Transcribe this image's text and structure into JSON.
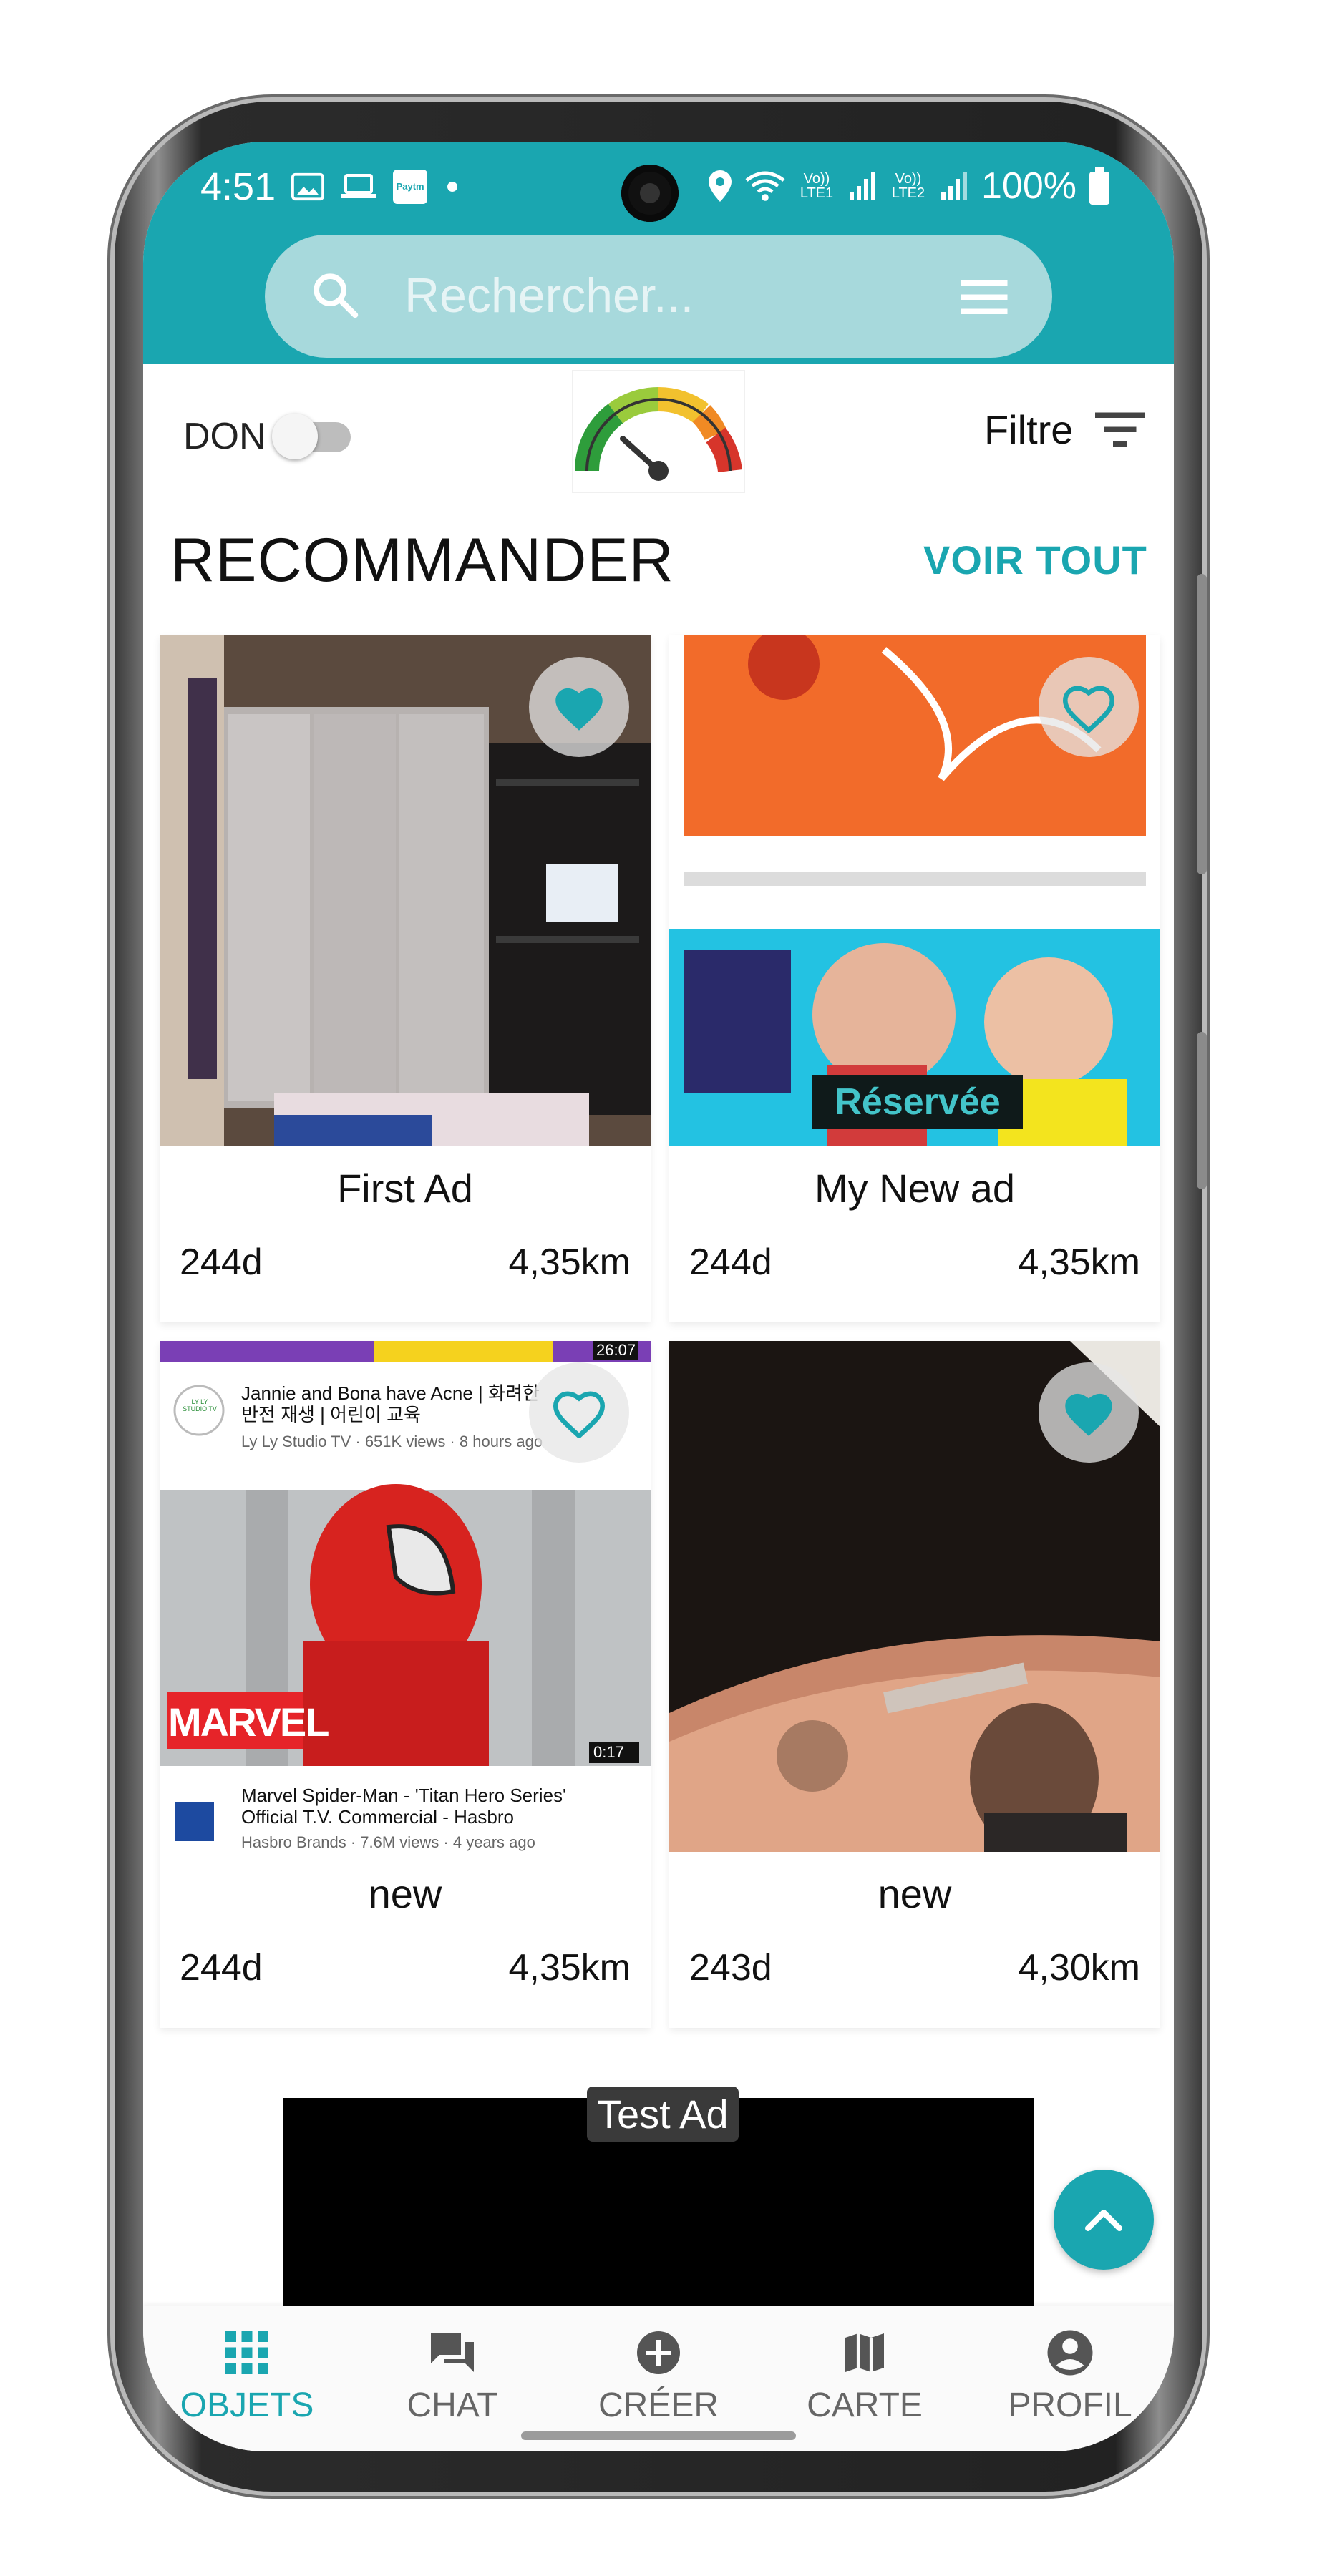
{
  "status": {
    "time": "4:51",
    "volte": "Vo)) LTE1",
    "volte2": "Vo)) LTE2",
    "battery": "100%",
    "paytm": "Paytm"
  },
  "search": {
    "placeholder": "Rechercher..."
  },
  "filterbar": {
    "don_label": "DON",
    "filter_label": "Filtre"
  },
  "section": {
    "title": "RECOMMANDER",
    "see_all": "VOIR TOUT"
  },
  "cards": [
    {
      "title": "First Ad",
      "age": "244d",
      "distance": "4,35km",
      "favorite": true
    },
    {
      "title": "My New ad",
      "age": "244d",
      "distance": "4,35km",
      "favorite": false,
      "badge": "Réservée"
    },
    {
      "title": "new",
      "age": "244d",
      "distance": "4,35km",
      "favorite": false
    },
    {
      "title": "new",
      "age": "243d",
      "distance": "4,30km",
      "favorite": true
    }
  ],
  "thumb_texts": {
    "yt1_title": "Jannie and Bona have Acne | 화려한 반전 재생 | 어린이 교육",
    "yt1_sub": "Ly Ly Studio TV · 651K views · 8 hours ago",
    "yt1_time": "26:07",
    "yt2_title": "Marvel Spider-Man - 'Titan Hero Series' Official T.V. Commercial - Hasbro",
    "yt2_sub": "Hasbro Brands · 7.6M views · 4 years ago",
    "yt2_time": "0:17",
    "marvel": "MARVEL",
    "lyly": "LY LY STUDIO TV"
  },
  "ad": {
    "label": "Test Ad"
  },
  "nav": [
    {
      "label": "OBJETS",
      "icon": "grid-icon",
      "active": true
    },
    {
      "label": "CHAT",
      "icon": "chat-icon",
      "active": false
    },
    {
      "label": "CRÉER",
      "icon": "add-circle-icon",
      "active": false
    },
    {
      "label": "CARTE",
      "icon": "map-icon",
      "active": false
    },
    {
      "label": "PROFIL",
      "icon": "account-icon",
      "active": false
    }
  ],
  "colors": {
    "accent": "#1aa6b0",
    "search_bg": "#a7d9dc",
    "reserved_text": "#43c4c9"
  }
}
